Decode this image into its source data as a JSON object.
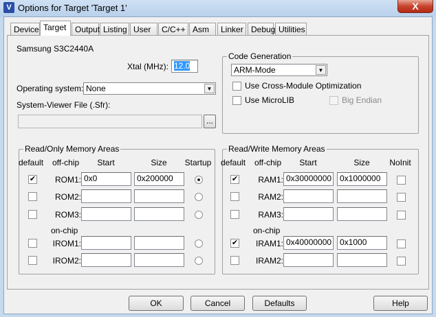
{
  "window": {
    "title": "Options for Target 'Target 1'",
    "close": "X",
    "icon": "V"
  },
  "tabs": [
    "Device",
    "Target",
    "Output",
    "Listing",
    "User",
    "C/C++",
    "Asm",
    "Linker",
    "Debug",
    "Utilities"
  ],
  "device": "Samsung S3C2440A",
  "xtal": {
    "label": "Xtal (MHz):",
    "value": "12.0"
  },
  "os": {
    "label": "Operating system:",
    "value": "None"
  },
  "sfr": {
    "label": "System-Viewer File (.Sfr):",
    "value": "",
    "browse": "..."
  },
  "codegen": {
    "title": "Code Generation",
    "mode": "ARM-Mode",
    "cross_module": {
      "label": "Use Cross-Module Optimization",
      "checked": false
    },
    "microlib": {
      "label": "Use MicroLIB",
      "checked": false
    },
    "big_endian": {
      "label": "Big Endian",
      "checked": false,
      "disabled": true
    }
  },
  "rom": {
    "title": "Read/Only Memory Areas",
    "headers": {
      "default": "default",
      "offchip": "off-chip",
      "start": "Start",
      "size": "Size",
      "extra": "Startup",
      "onchip": "on-chip"
    },
    "rows": [
      {
        "name": "ROM1:",
        "default": true,
        "start": "0x0",
        "size": "0x200000",
        "extra": true
      },
      {
        "name": "ROM2:",
        "default": false,
        "start": "",
        "size": "",
        "extra": false
      },
      {
        "name": "ROM3:",
        "default": false,
        "start": "",
        "size": "",
        "extra": false
      },
      {
        "name": "IROM1:",
        "default": false,
        "start": "",
        "size": "",
        "extra": false
      },
      {
        "name": "IROM2:",
        "default": false,
        "start": "",
        "size": "",
        "extra": false
      }
    ]
  },
  "ram": {
    "title": "Read/Write Memory Areas",
    "headers": {
      "default": "default",
      "offchip": "off-chip",
      "start": "Start",
      "size": "Size",
      "extra": "NoInit",
      "onchip": "on-chip"
    },
    "rows": [
      {
        "name": "RAM1:",
        "default": true,
        "start": "0x30000000",
        "size": "0x1000000",
        "extra": false
      },
      {
        "name": "RAM2:",
        "default": false,
        "start": "",
        "size": "",
        "extra": false
      },
      {
        "name": "RAM3:",
        "default": false,
        "start": "",
        "size": "",
        "extra": false
      },
      {
        "name": "IRAM1:",
        "default": true,
        "start": "0x40000000",
        "size": "0x1000",
        "extra": false
      },
      {
        "name": "IRAM2:",
        "default": false,
        "start": "",
        "size": "",
        "extra": false
      }
    ]
  },
  "buttons": {
    "ok": "OK",
    "cancel": "Cancel",
    "defaults": "Defaults",
    "help": "Help"
  }
}
